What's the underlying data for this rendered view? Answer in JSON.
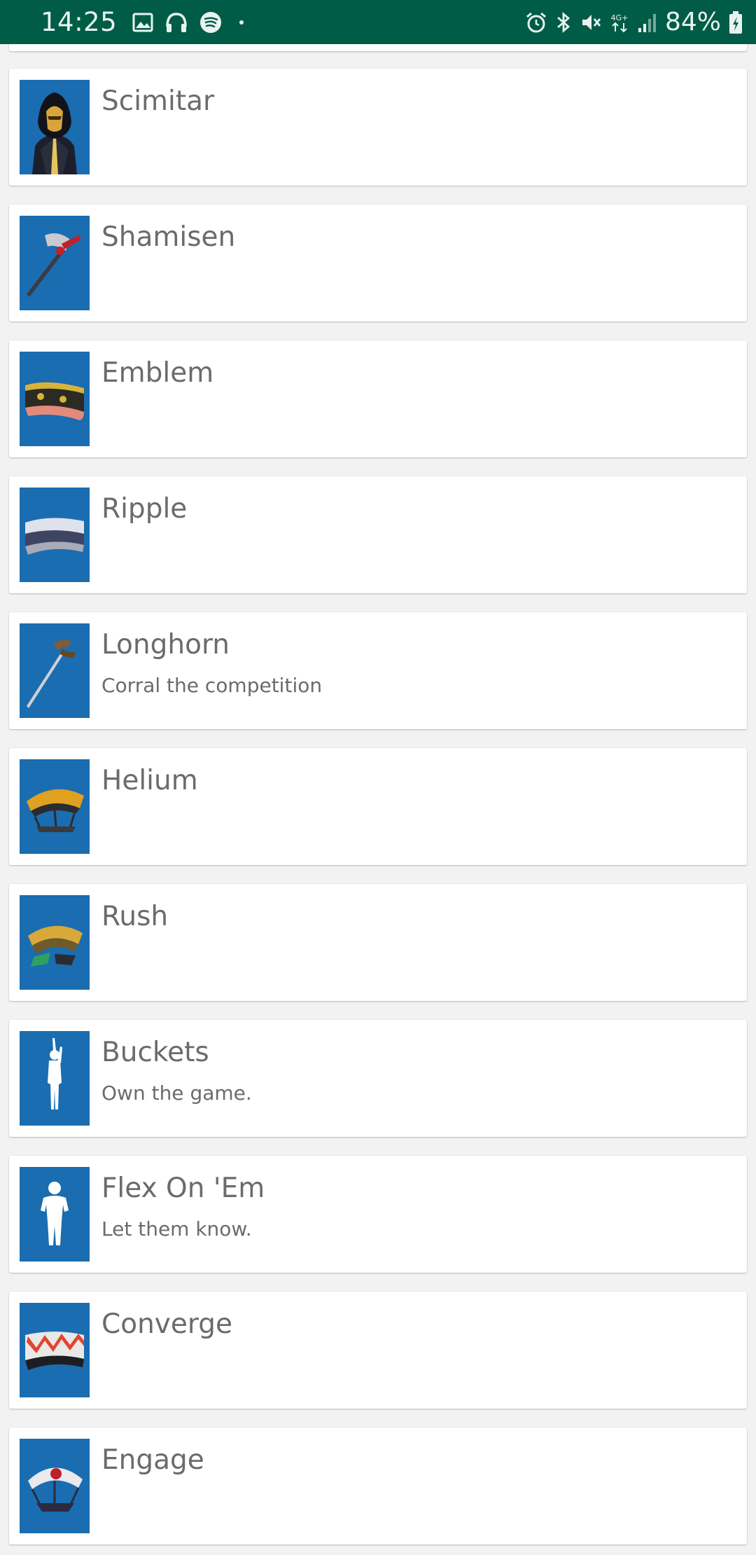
{
  "status_bar": {
    "time": "14:25",
    "battery": "84%",
    "network": "4G+",
    "icons": [
      "gallery-icon",
      "headphones-icon",
      "spotify-icon",
      "dot-icon",
      "alarm-icon",
      "bluetooth-icon",
      "mute-icon",
      "network-4g-icon",
      "signal-icon",
      "battery-charging-icon"
    ],
    "background": "#015c47"
  },
  "colors": {
    "thumb_background": "#1a6db0",
    "text": "#6b6b6b",
    "page_background": "#f2f2f2"
  },
  "items": [
    {
      "title": "Scimitar",
      "description": "",
      "icon": "outfit-icon"
    },
    {
      "title": "Shamisen",
      "description": "",
      "icon": "pickaxe-icon"
    },
    {
      "title": "Emblem",
      "description": "",
      "icon": "wrap-icon"
    },
    {
      "title": "Ripple",
      "description": "",
      "icon": "wrap-icon"
    },
    {
      "title": "Longhorn",
      "description": "Corral the competition",
      "icon": "pickaxe-icon"
    },
    {
      "title": "Helium",
      "description": "",
      "icon": "glider-icon"
    },
    {
      "title": "Rush",
      "description": "",
      "icon": "glider-icon"
    },
    {
      "title": "Buckets",
      "description": "Own the game.",
      "icon": "emote-icon"
    },
    {
      "title": "Flex On 'Em",
      "description": "Let them know.",
      "icon": "emote-icon"
    },
    {
      "title": "Converge",
      "description": "",
      "icon": "wrap-icon"
    },
    {
      "title": "Engage",
      "description": "",
      "icon": "glider-icon"
    }
  ]
}
